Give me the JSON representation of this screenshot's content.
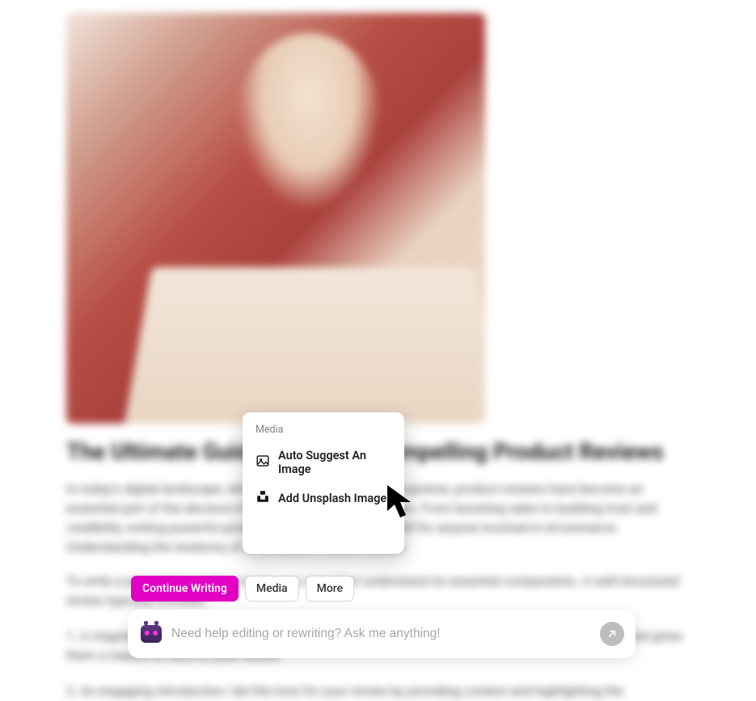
{
  "article": {
    "title": "The Ultimate Guide to Writing Compelling Product Reviews",
    "paragraphs": [
      "In today's digital landscape, where online shopping reigns supreme, product reviews have become an essential part of the decision-making process for consumers. From boosting sales to building trust and credibility, writing powerful product reviews is a valuable skill for anyone involved in eCommerce. Understanding the Anatomy of an Effective Product Review",
      "To write a persuasive product review, you must first understand its essential components. A well-structured review typically includes:",
      "1. A magnetic title: Capture the attention of potential readers with a title that piques their curiosity and gives them a reason to click on your review.",
      "2. An engaging introduction: Set the tone for your review by providing context and highlighting the"
    ]
  },
  "popup": {
    "label": "Media",
    "items": [
      "Auto Suggest An Image",
      "Add Unsplash Image"
    ]
  },
  "toolbar": {
    "continue": "Continue Writing",
    "media": "Media",
    "more": "More"
  },
  "chat": {
    "placeholder": "Need help editing or rewriting? Ask me anything!"
  }
}
